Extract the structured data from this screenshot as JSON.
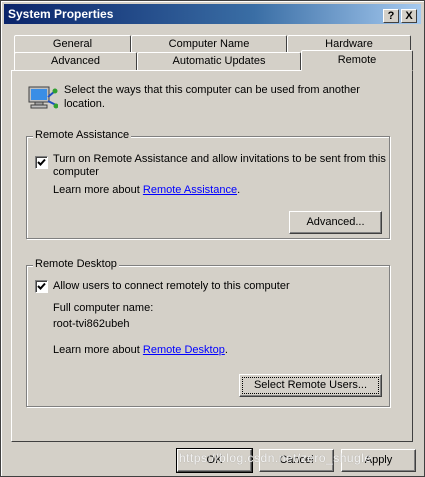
{
  "window": {
    "title": "System Properties",
    "help_button": "?",
    "close_button": "X"
  },
  "tabs": {
    "row1": [
      "General",
      "Computer Name",
      "Hardware"
    ],
    "row2": [
      "Advanced",
      "Automatic Updates",
      "Remote"
    ],
    "active": "Remote"
  },
  "intro": {
    "icon": "computer-network-icon",
    "text_line1": "Select the ways that this computer can be used from another",
    "text_line2": "location."
  },
  "remote_assistance": {
    "group_title": "Remote Assistance",
    "checkbox_checked": true,
    "checkbox_label_line1": "Turn on Remote Assistance and allow invitations to be sent from this",
    "checkbox_label_line2": "computer",
    "learn_more_prefix": "Learn more about",
    "learn_more_link": "Remote Assistance",
    "learn_more_suffix": ".",
    "advanced_button": "Advanced..."
  },
  "remote_desktop": {
    "group_title": "Remote Desktop",
    "checkbox_checked": true,
    "checkbox_label": "Allow users to connect remotely to this computer",
    "full_name_label": "Full computer name:",
    "full_name_value": "root-tvi862ubeh",
    "learn_more_prefix": "Learn more about",
    "learn_more_link": "Remote Desktop",
    "learn_more_suffix": ".",
    "select_users_button": "Select Remote Users..."
  },
  "footer": {
    "ok": "OK",
    "cancel": "Cancel",
    "apply": "Apply"
  },
  "watermark": "https://blog.csdn.net/zero_shugle",
  "colors": {
    "face": "#d4d0c8",
    "title_start": "#0a246a",
    "title_end": "#a6caf0",
    "link": "#0000ff"
  }
}
